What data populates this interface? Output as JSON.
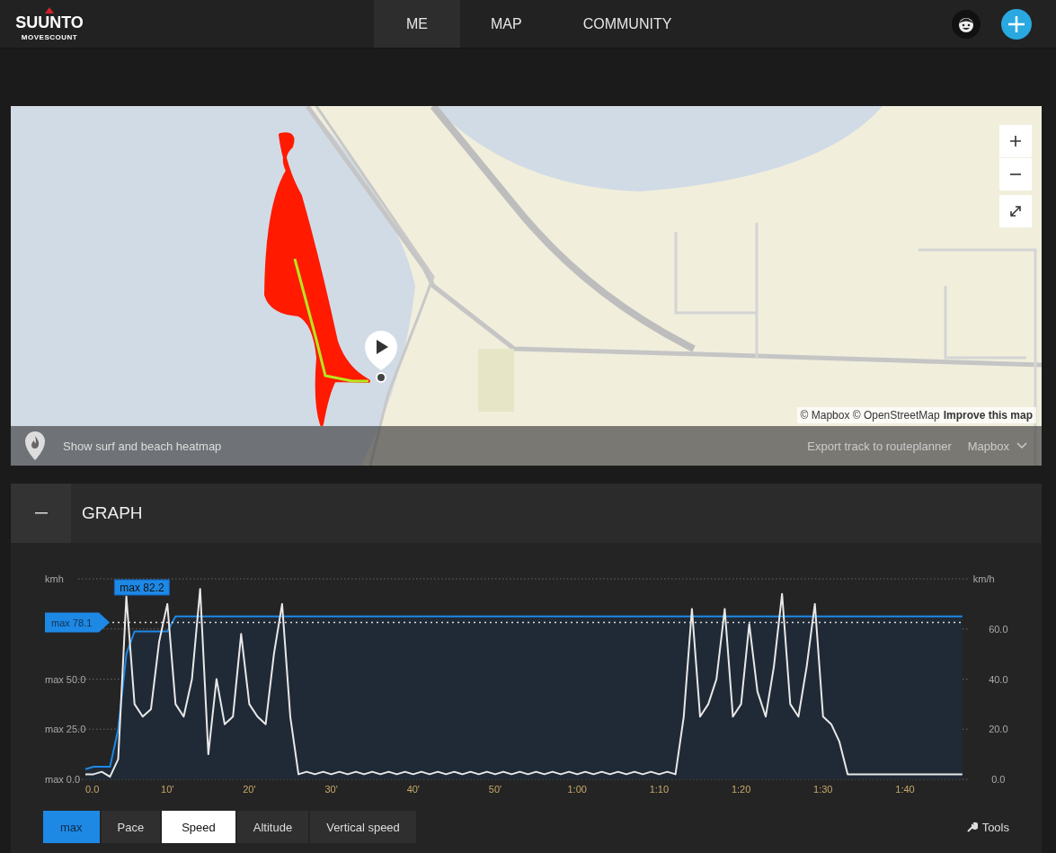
{
  "nav": {
    "brand": "SUUNTO",
    "sub_brand": "MOVESCOUNT",
    "tabs": [
      {
        "label": "ME",
        "selected": true
      },
      {
        "label": "MAP",
        "selected": false
      },
      {
        "label": "COMMUNITY",
        "selected": false
      }
    ]
  },
  "map": {
    "attribution": "© Mapbox © OpenStreetMap",
    "improve_link": "Improve this map",
    "heatmap_label": "Show surf and beach heatmap",
    "export_link": "Export track to routeplanner",
    "layer_menu": "Mapbox"
  },
  "graph": {
    "title": "GRAPH",
    "left_unit": "kmh",
    "left_axis_labels": [
      "max 50.0",
      "max 25.0",
      "max 0.0"
    ],
    "chart_data": {
      "type": "line",
      "ylabel": "km/h",
      "xlim": [
        0,
        107
      ],
      "ylim": [
        0,
        80
      ],
      "grid": true,
      "yticks": [
        {
          "value": 0,
          "label": "0.0"
        },
        {
          "value": 20,
          "label": "20.0"
        },
        {
          "value": 40,
          "label": "40.0"
        },
        {
          "value": 60,
          "label": "60.0"
        }
      ],
      "xticks": [
        {
          "value": 0,
          "label": "0.0"
        },
        {
          "value": 10,
          "label": "10'"
        },
        {
          "value": 20,
          "label": "20'"
        },
        {
          "value": 30,
          "label": "30'"
        },
        {
          "value": 40,
          "label": "40'"
        },
        {
          "value": 50,
          "label": "50'"
        },
        {
          "value": 60,
          "label": "1:00"
        },
        {
          "value": 70,
          "label": "1:10"
        },
        {
          "value": 80,
          "label": "1:20"
        },
        {
          "value": 90,
          "label": "1:30"
        },
        {
          "value": 100,
          "label": "1:40"
        }
      ],
      "x": [
        0,
        1,
        2,
        3,
        4,
        5,
        6,
        7,
        8,
        9,
        10,
        11,
        12,
        13,
        14,
        15,
        16,
        17,
        18,
        19,
        20,
        21,
        22,
        23,
        24,
        25,
        26,
        27,
        28,
        29,
        30,
        31,
        32,
        33,
        34,
        35,
        36,
        37,
        38,
        39,
        40,
        41,
        42,
        43,
        44,
        45,
        46,
        47,
        48,
        49,
        50,
        51,
        52,
        53,
        54,
        55,
        56,
        57,
        58,
        59,
        60,
        61,
        62,
        63,
        64,
        65,
        66,
        67,
        68,
        69,
        70,
        71,
        72,
        73,
        74,
        75,
        76,
        77,
        78,
        79,
        80,
        81,
        82,
        83,
        84,
        85,
        86,
        87,
        88,
        89,
        90,
        91,
        92,
        93,
        94,
        95,
        96,
        97,
        98,
        99,
        100,
        101,
        102,
        103,
        104,
        105,
        106,
        107
      ],
      "series": [
        {
          "color": "#e8e8e8",
          "values": [
            2,
            2,
            3,
            1,
            8,
            73,
            30,
            25,
            28,
            55,
            70,
            30,
            25,
            40,
            76,
            10,
            40,
            22,
            25,
            58,
            30,
            25,
            22,
            50,
            70,
            25,
            2,
            3,
            2,
            3,
            2,
            3,
            2,
            3,
            2,
            3,
            2,
            3,
            2,
            3,
            2,
            3,
            2,
            3,
            2,
            3,
            2,
            3,
            2,
            3,
            2,
            3,
            2,
            3,
            2,
            3,
            2,
            3,
            2,
            3,
            2,
            3,
            2,
            3,
            2,
            3,
            2,
            3,
            2,
            3,
            2,
            3,
            2,
            25,
            68,
            25,
            30,
            40,
            68,
            25,
            30,
            62,
            35,
            25,
            45,
            74,
            30,
            25,
            45,
            70,
            25,
            22,
            15,
            2,
            2,
            2,
            2,
            2,
            2,
            2,
            2,
            2,
            2,
            2,
            2,
            2,
            2,
            2
          ]
        },
        {
          "type": "area",
          "color": "#1e88e5",
          "values": [
            4,
            5,
            5,
            5,
            20,
            50,
            59,
            59,
            59,
            59,
            59,
            65,
            65,
            65,
            65,
            65,
            65,
            65,
            65,
            65,
            65,
            65,
            65,
            65,
            65,
            65,
            65,
            65,
            65,
            65,
            65,
            65,
            65,
            65,
            65,
            65,
            65,
            65,
            65,
            65,
            65,
            65,
            65,
            65,
            65,
            65,
            65,
            65,
            65,
            65,
            65,
            65,
            65,
            65,
            65,
            65,
            65,
            65,
            65,
            65,
            65,
            65,
            65,
            65,
            65,
            65,
            65,
            65,
            65,
            65,
            65,
            65,
            65,
            65,
            65,
            65,
            65,
            65,
            65,
            65,
            65,
            65,
            65,
            65,
            65,
            65,
            65,
            65,
            65,
            65,
            65,
            65,
            65,
            65,
            65,
            65,
            65,
            65,
            65,
            65,
            65,
            65,
            65,
            65,
            65,
            65,
            65,
            65
          ]
        }
      ],
      "ref_lines": [
        {
          "axis": "y",
          "value": 62.6,
          "label": "max 78.1"
        }
      ],
      "annotations": [
        "max 82.2"
      ]
    },
    "modes": [
      {
        "label": "max",
        "kind": "toggle",
        "on": true
      },
      {
        "label": "Pace",
        "kind": "metric",
        "selected": false
      },
      {
        "label": "Speed",
        "kind": "metric",
        "selected": true
      },
      {
        "label": "Altitude",
        "kind": "metric",
        "selected": false
      },
      {
        "label": "Vertical speed",
        "kind": "metric",
        "selected": false
      }
    ],
    "tools_label": "Tools"
  }
}
